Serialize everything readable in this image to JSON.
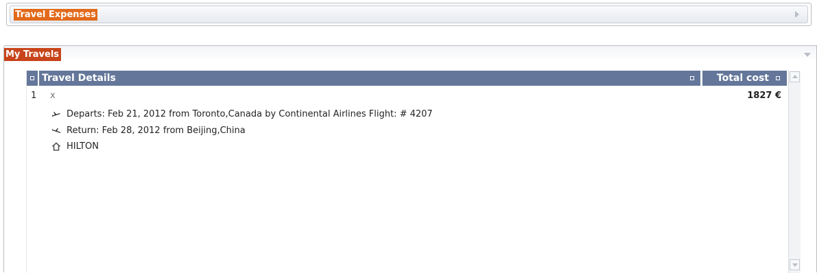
{
  "travel_expenses": {
    "title": "Travel Expenses",
    "expand_icon": "triangle-right-icon"
  },
  "my_travels": {
    "title": "My Travels",
    "collapse_icon": "triangle-down-icon",
    "table": {
      "columns": {
        "details": "Travel Details",
        "cost": "Total cost"
      },
      "rows": [
        {
          "number": "1",
          "marker": "x",
          "total_cost": "1827 €",
          "departs": "Departs: Feb 21, 2012 from Toronto,Canada by Continental Airlines Flight: # 4207",
          "return": "Return: Feb 28, 2012 from Beijing,China",
          "hotel": "HILTON"
        }
      ]
    }
  },
  "colors": {
    "header_bg": "#64779a",
    "title_highlight": "#c8441a",
    "top_title_highlight": "#e2691a"
  }
}
